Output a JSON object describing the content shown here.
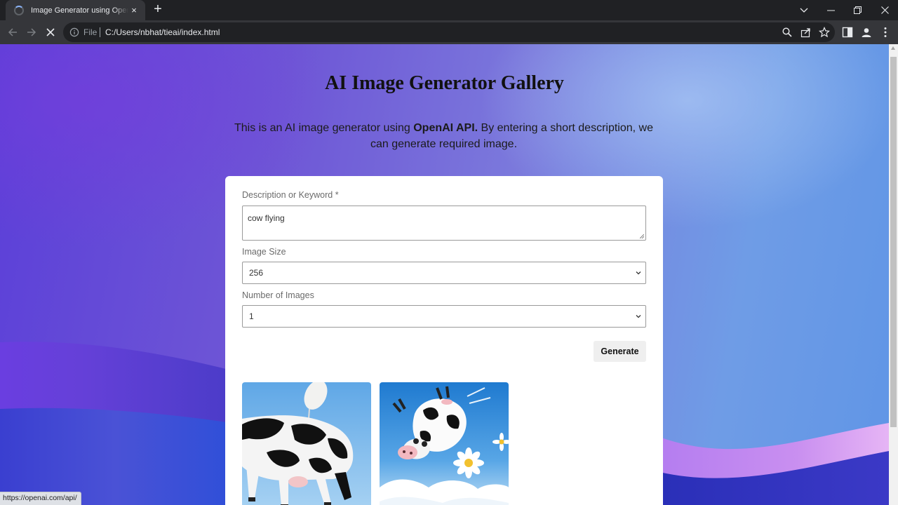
{
  "browser": {
    "tab_title": "Image Generator using OpenAI API",
    "tab_close": "×",
    "new_tab": "+",
    "omnibox_scheme": "File",
    "url": "C:/Users/nbhat/tieai/index.html",
    "status_url": "https://openai.com/api/"
  },
  "icons": [
    "loading-spinner-icon",
    "close-icon",
    "plus-icon",
    "chevron-down-icon",
    "minimize-icon",
    "restore-icon",
    "back-arrow-icon",
    "forward-arrow-icon",
    "stop-loading-icon",
    "info-icon",
    "zoom-icon",
    "share-icon",
    "star-icon",
    "side-panel-icon",
    "profile-icon",
    "kebab-menu-icon"
  ],
  "page": {
    "title": "AI Image Generator Gallery",
    "intro_before": "This is an AI image generator using ",
    "intro_bold": "OpenAI API.",
    "intro_after": " By entering a short description, we can generate required image."
  },
  "form": {
    "description_label": "Description or Keyword *",
    "description_value": "cow flying",
    "size_label": "Image Size",
    "size_value": "256",
    "count_label": "Number of Images",
    "count_value": "1",
    "generate_label": "Generate"
  },
  "gallery": {
    "images": [
      {
        "subject": "flying cow with balloon",
        "colors": {
          "sky": "#8cc4ee",
          "cow_body": "#f4f4f4",
          "cow_spots": "#111111"
        }
      },
      {
        "subject": "cartoon cow flying over clouds with daisies",
        "colors": {
          "sky": "#3a8fd6",
          "cloud": "#ffffff",
          "daisy": "#ffffff",
          "daisy_center": "#f2c12e"
        }
      }
    ]
  },
  "colors": {
    "chrome_dark": "#202124",
    "chrome_toolbar": "#35363a",
    "background_purple": "#5b3fd8",
    "background_blue": "#5f95e6",
    "card": "#ffffff",
    "button": "#efefef"
  }
}
